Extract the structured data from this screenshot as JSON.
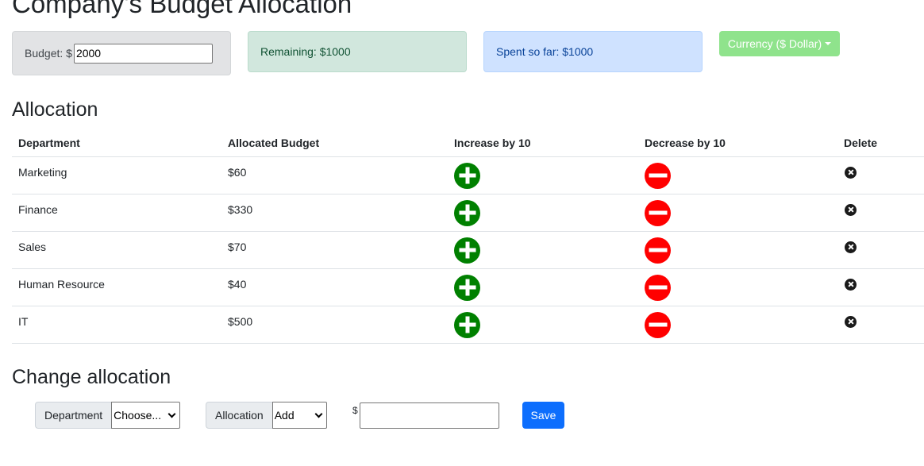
{
  "header": {
    "title": "Company's Budget Allocation"
  },
  "stats": {
    "budget_label": "Budget: $",
    "budget_value": "2000",
    "remaining": "Remaining: $1000",
    "spent": "Spent so far: $1000",
    "currency_label": "Currency ($ Dollar)"
  },
  "allocation": {
    "heading": "Allocation",
    "columns": [
      "Department",
      "Allocated Budget",
      "Increase by 10",
      "Decrease by 10",
      "Delete"
    ],
    "rows": [
      {
        "department": "Marketing",
        "budget": "$60"
      },
      {
        "department": "Finance",
        "budget": "$330"
      },
      {
        "department": "Sales",
        "budget": "$70"
      },
      {
        "department": "Human Resource",
        "budget": "$40"
      },
      {
        "department": "IT",
        "budget": "$500"
      }
    ]
  },
  "change": {
    "heading": "Change allocation",
    "department_label": "Department",
    "department_selected": "Choose...",
    "allocation_label": "Allocation",
    "allocation_selected": "Add",
    "currency_symbol": "$",
    "amount_value": "",
    "save_label": "Save"
  },
  "colors": {
    "increase": "#008000",
    "decrease": "#ff0000",
    "currency_button": "#8fe38c",
    "save_button": "#0d6efd",
    "remaining_bg": "#d1e7dd",
    "spent_bg": "#cfe2ff",
    "budget_bg": "#e2e3e5"
  },
  "icons": {
    "increase": "plus-circle-icon",
    "decrease": "minus-circle-icon",
    "delete": "x-circle-icon",
    "dropdown": "caret-down-icon"
  }
}
